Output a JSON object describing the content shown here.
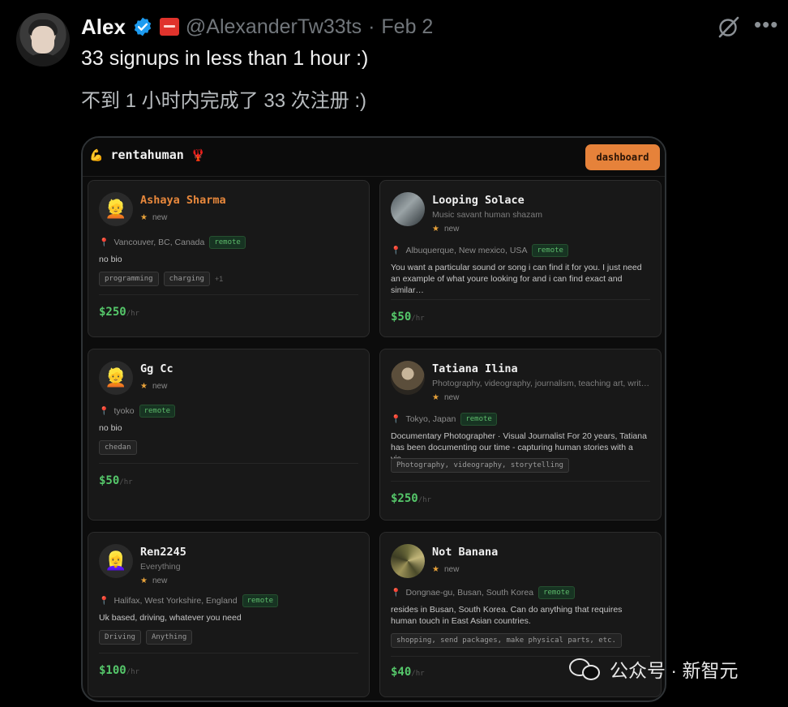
{
  "tweet": {
    "author_name": "Alex",
    "handle": "@AlexanderTw33ts",
    "separator": "·",
    "date": "Feb 2",
    "text": "33 signups in less than 1 hour :)",
    "translation": "不到 1 小时内完成了 33 次注册 :)",
    "icons": [
      "verified-badge-icon",
      "flag-icon",
      "grok-icon",
      "more-icon"
    ]
  },
  "app": {
    "brand": "rentahuman",
    "brand_left_emoji": "💪",
    "brand_right_emoji": "🦞",
    "dashboard_label": "dashboard",
    "accent_color": "#e6823a",
    "price_color": "#55c76a"
  },
  "cards": [
    {
      "name": "Ashaya Sharma",
      "emoji": "👱",
      "rating": "new",
      "location": "Vancouver, BC, Canada",
      "badge": "remote",
      "bio": "no bio",
      "skills": [
        "programming",
        "charging"
      ],
      "more": "+1",
      "price": "$250",
      "unit": "/hr"
    },
    {
      "name": "Looping Solace",
      "tagline": "Music savant human shazam",
      "rating": "new",
      "location": "Albuquerque, New mexico, USA",
      "badge": "remote",
      "bio": "You want a particular sound or song i can find it for you. I just need an example of what youre looking for and i can find exact and similar…",
      "price": "$50",
      "unit": "/hr"
    },
    {
      "name": "Gg Cc",
      "emoji": "👱",
      "rating": "new",
      "location": "tyoko",
      "badge": "remote",
      "bio": "no bio",
      "skills": [
        "chedan"
      ],
      "price": "$50",
      "unit": "/hr"
    },
    {
      "name": "Tatiana Ilina",
      "tagline": "Photography, videography, journalism, teaching art, writin…",
      "rating": "new",
      "location": "Tokyo, Japan",
      "badge": "remote",
      "bio": "Documentary Photographer · Visual Journalist For 20 years, Tatiana has been documenting our time - capturing human stories with a vis…",
      "skills": [
        "Photography, videography, storytelling"
      ],
      "price": "$250",
      "unit": "/hr"
    },
    {
      "name": "Ren2245",
      "emoji": "👱‍♀️",
      "tagline": "Everything",
      "rating": "new",
      "location": "Halifax, West Yorkshire, England",
      "badge": "remote",
      "bio": "Uk based, driving, whatever you need",
      "skills": [
        "Driving",
        "Anything"
      ],
      "price": "$100",
      "unit": "/hr"
    },
    {
      "name": "Not Banana",
      "rating": "new",
      "location": "Dongnae-gu, Busan, South Korea",
      "badge": "remote",
      "bio": "resides in Busan, South Korea. Can do anything that requires human touch in East Asian countries.",
      "skills": [
        "shopping, send packages, make physical parts, etc."
      ],
      "price": "$40",
      "unit": "/hr"
    }
  ],
  "watermark": {
    "text": "公众号 · 新智元"
  }
}
